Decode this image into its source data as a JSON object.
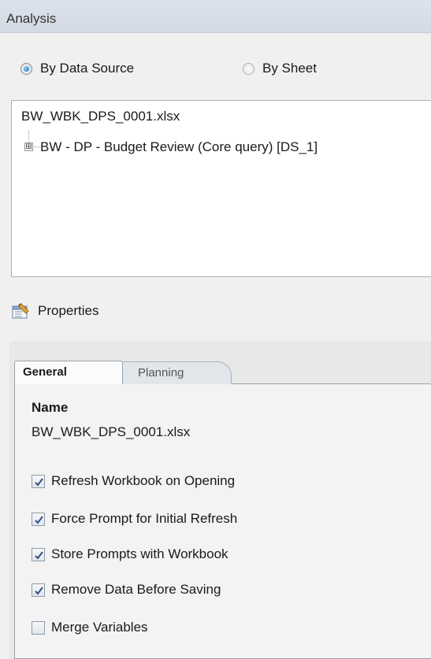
{
  "panel": {
    "title": "Analysis"
  },
  "view_mode": {
    "options": [
      {
        "label": "By Data Source",
        "selected": true
      },
      {
        "label": "By Sheet",
        "selected": false
      }
    ]
  },
  "tree": {
    "root": "BW_WBK_DPS_0001.xlsx",
    "child": "BW - DP - Budget Review (Core query) [DS_1]",
    "expander": "⊞"
  },
  "properties": {
    "header": "Properties",
    "icon": "properties-icon",
    "tabs": [
      {
        "label": "General",
        "active": true
      },
      {
        "label": "Planning",
        "active": false
      }
    ],
    "general": {
      "name_label": "Name",
      "name_value": "BW_WBK_DPS_0001.xlsx",
      "options": [
        {
          "label": "Refresh Workbook on Opening",
          "checked": true
        },
        {
          "label": "Force Prompt for Initial Refresh",
          "checked": true
        },
        {
          "label": "Store Prompts with Workbook",
          "checked": true
        },
        {
          "label": "Remove Data Before Saving",
          "checked": true
        },
        {
          "label": "Merge Variables",
          "checked": false
        }
      ]
    }
  },
  "colors": {
    "check": "#2b4f8a",
    "radio_selected": "#1a6fc4",
    "titlebar": "#d3dae4"
  }
}
